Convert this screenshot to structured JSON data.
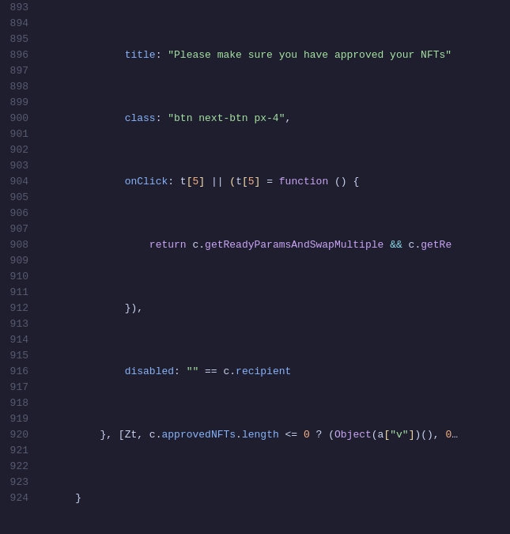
{
  "editor": {
    "lines": [
      {
        "num": "893",
        "tokens": []
      },
      {
        "num": "894",
        "tokens": []
      },
      {
        "num": "895",
        "tokens": []
      },
      {
        "num": "896",
        "tokens": []
      },
      {
        "num": "897",
        "tokens": []
      },
      {
        "num": "898",
        "tokens": []
      },
      {
        "num": "899",
        "tokens": []
      },
      {
        "num": "900",
        "tokens": []
      },
      {
        "num": "901",
        "tokens": []
      },
      {
        "num": "902",
        "tokens": []
      },
      {
        "num": "903",
        "tokens": []
      },
      {
        "num": "904",
        "tokens": []
      },
      {
        "num": "905",
        "tokens": []
      },
      {
        "num": "906",
        "tokens": []
      },
      {
        "num": "907",
        "tokens": []
      },
      {
        "num": "908",
        "tokens": []
      },
      {
        "num": "909",
        "tokens": []
      },
      {
        "num": "910",
        "tokens": []
      },
      {
        "num": "911",
        "tokens": []
      },
      {
        "num": "912",
        "tokens": []
      },
      {
        "num": "913",
        "tokens": []
      },
      {
        "num": "914",
        "tokens": []
      },
      {
        "num": "915",
        "tokens": []
      },
      {
        "num": "916",
        "tokens": []
      },
      {
        "num": "917",
        "tokens": []
      },
      {
        "num": "918",
        "tokens": []
      },
      {
        "num": "919",
        "tokens": []
      },
      {
        "num": "920",
        "tokens": []
      },
      {
        "num": "921",
        "tokens": []
      },
      {
        "num": "922",
        "tokens": []
      },
      {
        "num": "923",
        "tokens": []
      },
      {
        "num": "924",
        "tokens": []
      }
    ]
  }
}
